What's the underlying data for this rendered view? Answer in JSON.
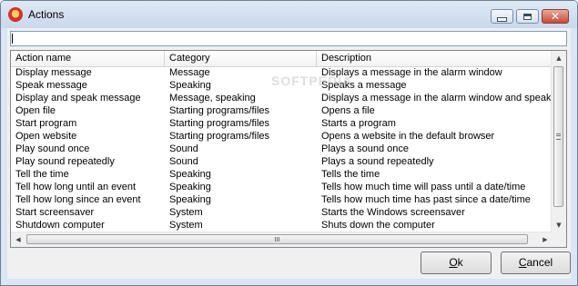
{
  "window": {
    "title": "Actions",
    "icon": "alarm-clock-icon",
    "controls": {
      "minimize": "minimize-icon",
      "maximize": "maximize-icon",
      "close": "✕"
    }
  },
  "filter": {
    "value": "",
    "placeholder": ""
  },
  "list": {
    "columns": [
      "Action name",
      "Category",
      "Description"
    ],
    "rows": [
      [
        "Display message",
        "Message",
        "Displays a message in the alarm window"
      ],
      [
        "Speak message",
        "Speaking",
        "Speaks a message"
      ],
      [
        "Display and speak message",
        "Message, speaking",
        "Displays a message in the alarm window and speaks"
      ],
      [
        "Open file",
        "Starting programs/files",
        "Opens a file"
      ],
      [
        "Start program",
        "Starting programs/files",
        "Starts a program"
      ],
      [
        "Open website",
        "Starting programs/files",
        "Opens a website in the default browser"
      ],
      [
        "Play sound once",
        "Sound",
        "Plays a sound once"
      ],
      [
        "Play sound repeatedly",
        "Sound",
        "Plays a sound repeatedly"
      ],
      [
        "Tell the time",
        "Speaking",
        "Tells the time"
      ],
      [
        "Tell how long until an event",
        "Speaking",
        "Tells how much time will pass until a date/time"
      ],
      [
        "Tell how long since an event",
        "Speaking",
        "Tells how much time has past since a date/time"
      ],
      [
        "Start screensaver",
        "System",
        "Starts the Windows screensaver"
      ],
      [
        "Shutdown computer",
        "System",
        "Shuts down the computer"
      ]
    ]
  },
  "watermark": "SOFTPEDIA",
  "buttons": {
    "ok_prefix": "",
    "ok_underlined": "O",
    "ok_rest": "k",
    "cancel_underlined": "C",
    "cancel_rest": "ancel"
  }
}
